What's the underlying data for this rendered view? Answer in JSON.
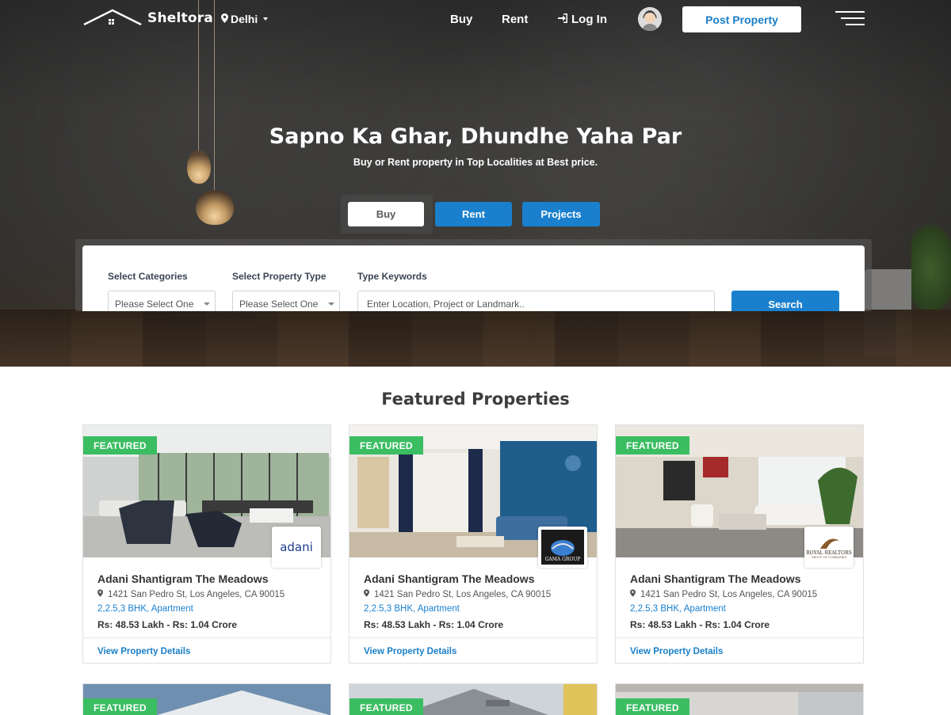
{
  "brand": {
    "name": "Sheltora",
    "city": "Delhi"
  },
  "nav": {
    "buy": "Buy",
    "rent": "Rent",
    "login": "Log In",
    "post_property": "Post Property"
  },
  "hero": {
    "headline": "Sapno Ka Ghar, Dhundhe Yaha Par",
    "subline": "Buy or Rent property in Top Localities at Best price.",
    "tabs": [
      "Buy",
      "Rent",
      "Projects"
    ],
    "active_tab": "Buy"
  },
  "search": {
    "categories_label": "Select Categories",
    "categories_value": "Please Select One",
    "property_type_label": "Select Property Type",
    "property_type_value": "Please Select One",
    "keywords_label": "Type Keywords",
    "keywords_placeholder": "Enter Location, Project or Landmark..",
    "button": "Search"
  },
  "featured": {
    "title": "Featured Properties",
    "cards": [
      {
        "badge": "FEATURED",
        "builder": "adani",
        "title": "Adani Shantigram The Meadows",
        "address": "1421 San Pedro St, Los Angeles, CA 90015",
        "type": "2,2.5,3 BHK, Apartment",
        "price": "Rs: 48.53 Lakh - Rs: 1.04 Crore",
        "link": "View Property Details"
      },
      {
        "badge": "FEATURED",
        "builder": "GAMA GROUP",
        "title": "Adani Shantigram The Meadows",
        "address": "1421 San Pedro St, Los Angeles, CA 90015",
        "type": "2,2.5,3 BHK, Apartment",
        "price": "Rs: 48.53 Lakh - Rs: 1.04 Crore",
        "link": "View Property Details"
      },
      {
        "badge": "FEATURED",
        "builder": "ROYAL REALTORS",
        "builder_sub": "GROUP OF COMPANIES",
        "title": "Adani Shantigram The Meadows",
        "address": "1421 San Pedro St, Los Angeles, CA 90015",
        "type": "2,2.5,3 BHK, Apartment",
        "price": "Rs: 48.53 Lakh - Rs: 1.04 Crore",
        "link": "View Property Details"
      }
    ],
    "next_row_badges": [
      "FEATURED",
      "FEATURED",
      "FEATURED"
    ]
  },
  "colors": {
    "primary": "#1a80ce",
    "featured_badge": "#3bbd62",
    "heading": "#3d3d3d"
  },
  "icons": [
    "home-roof-logo-icon",
    "map-pin-icon",
    "login-icon",
    "avatar-headset-icon",
    "hamburger-menu-icon",
    "chevron-down-icon"
  ]
}
